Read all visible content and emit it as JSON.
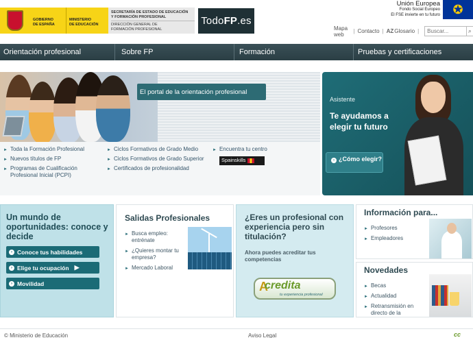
{
  "header": {
    "gov_line1": "GOBIERNO",
    "gov_line2": "DE ESPAÑA",
    "ministry_line1": "MINISTERIO",
    "ministry_line2": "DE EDUCACIÓN",
    "secretaria_line1": "SECRETARÍA DE ESTADO DE EDUCACIÓN",
    "secretaria_line2": "Y FORMACIÓN PROFESIONAL",
    "direccion_line1": "DIRECCIÓN GENERAL DE",
    "direccion_line2": "FORMACIÓN PROFESIONAL",
    "todofp_prefix": "Todo",
    "todofp_bold": "FP",
    "todofp_suffix": ".es",
    "eu_title": "Unión Europea",
    "eu_fund": "Fondo Social Europeo",
    "eu_motto": "El FSE invierte en tu futuro",
    "util_links": {
      "sitemap": "Mapa web",
      "contact": "Contacto",
      "glossary": "Glosario"
    },
    "search_placeholder": "Buscar..."
  },
  "nav": {
    "items": [
      "Orientación profesional",
      "Sobre FP",
      "Formación",
      "Pruebas y certificaciones"
    ]
  },
  "hero": {
    "banner": "El portal de la orientación profesional",
    "col1": [
      "Toda la Formación Profesional",
      "Nuevos títulos de FP",
      "Programas de Cualificación Profesional Inicial (PCPI)"
    ],
    "col2": [
      "Ciclos Formativos de Grado Medio",
      "Ciclos Formativos de Grado Superior",
      "Certificados de profesionalidad"
    ],
    "col3": [
      "Encuentra tu centro"
    ],
    "spainskills_label": "Spainskills"
  },
  "assistant": {
    "label": "Asistente",
    "title": "Te ayudamos a elegir tu futuro",
    "button": "¿Cómo elegir?"
  },
  "panels": {
    "world": {
      "title": "Un mundo de oportunidades: conoce y decide",
      "buttons": [
        "Conoce tus habilidades",
        "Elige tu ocupación",
        "Movilidad"
      ]
    },
    "salidas": {
      "title": "Salidas Profesionales",
      "items": [
        "Busca empleo: entrénate",
        "¿Quieres montar tu empresa?",
        "Mercado Laboral"
      ]
    },
    "profesional": {
      "title": "¿Eres un profesional con experiencia pero sin titulación?",
      "subtitle": "Ahora puedes acreditar tus competencias",
      "acredita_big": "credita",
      "acredita_a": "A",
      "acredita_small": "tu experiencia profesional"
    },
    "info": {
      "title": "Información para...",
      "items": [
        "Profesores",
        "Empleadores"
      ]
    },
    "novedades": {
      "title": "Novedades",
      "items": [
        "Becas",
        "Actualidad",
        "Retransmisión en directo de la"
      ]
    }
  },
  "footer": {
    "copyright": "© Ministerio de Educación",
    "legal": "Aviso Legal",
    "logo": "cc"
  },
  "colors": {
    "nav_bg": "#2f444a",
    "accent_teal": "#1b6b76",
    "panel_blue": "#bfe1e8",
    "gov_yellow": "#f7d417",
    "eu_blue": "#003399"
  }
}
